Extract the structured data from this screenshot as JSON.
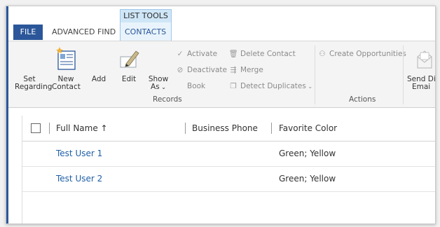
{
  "ribbon_tabs": {
    "context_group_title": "LIST TOOLS",
    "file": "FILE",
    "advanced_find": "ADVANCED FIND",
    "contacts": "CONTACTS"
  },
  "ribbon": {
    "set_regarding": [
      "Set",
      "Regarding"
    ],
    "new_contact": [
      "New",
      "Contact"
    ],
    "add": "Add",
    "edit": "Edit",
    "show_as": [
      "Show",
      "As"
    ],
    "activate": "Activate",
    "deactivate": "Deactivate",
    "book": "Book",
    "delete_contact": "Delete Contact",
    "merge": "Merge",
    "detect_duplicates": "Detect Duplicates",
    "create_opportunities": "Create Opportunities",
    "send_direct_email": [
      "Send Di",
      "Emai"
    ],
    "group_records": "Records",
    "group_actions": "Actions"
  },
  "grid": {
    "columns": {
      "full_name": "Full Name ↑",
      "business_phone": "Business Phone",
      "favorite_color": "Favorite Color"
    },
    "rows": [
      {
        "full_name": "Test User 1",
        "business_phone": "",
        "favorite_color": "Green; Yellow"
      },
      {
        "full_name": "Test User 2",
        "business_phone": "",
        "favorite_color": "Green; Yellow"
      }
    ]
  },
  "colors": {
    "accent": "#2b579a",
    "link": "#1f5fa6",
    "context_tab_bg": "#e8f3fb"
  },
  "icons": [
    "checkmark-icon",
    "deactivate-icon",
    "trash-icon",
    "merge-icon",
    "detect-duplicates-icon",
    "create-opportunities-icon",
    "new-contact-icon",
    "edit-pencil-icon",
    "email-icon",
    "dropdown-chevron-icon",
    "sort-ascending-icon"
  ]
}
